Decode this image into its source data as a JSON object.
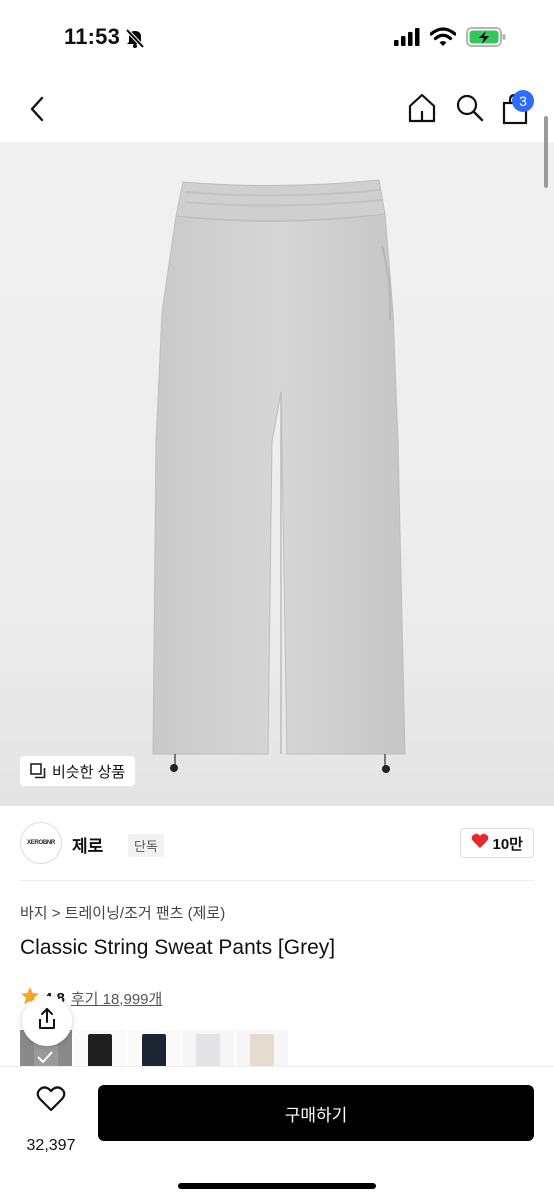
{
  "status_bar": {
    "time": "11:53"
  },
  "nav": {
    "cart_count": "3"
  },
  "hero": {
    "similar_label": "비슷한 상품"
  },
  "brand": {
    "logo_text": "XEROBNR",
    "name": "제로",
    "tag": "단독",
    "likes": "10만"
  },
  "product": {
    "breadcrumb": "바지 > 트레이닝/조거 팬츠 (제로)",
    "title": "Classic String Sweat Pants [Grey]",
    "rating": "4.8",
    "reviews": "후기 18,999개"
  },
  "swatches": [
    {
      "name": "grey",
      "color": "#8a8a8a",
      "selected": true
    },
    {
      "name": "black",
      "color": "#1e1e1e",
      "selected": false
    },
    {
      "name": "navy",
      "color": "#1d2535",
      "selected": false
    },
    {
      "name": "white",
      "color": "#e4e4e6",
      "selected": false
    },
    {
      "name": "beige",
      "color": "#e6dccd",
      "selected": false
    }
  ],
  "bottom_bar": {
    "wish_count": "32,397",
    "buy_label": "구매하기"
  },
  "colors": {
    "accent_blue": "#2f6bff",
    "heart_red": "#e8262b",
    "star_orange": "#f6a623",
    "buy_button": "#000000"
  }
}
